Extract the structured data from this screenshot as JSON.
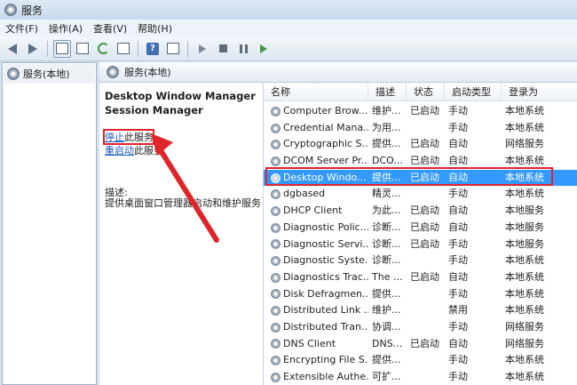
{
  "window": {
    "title": "服务"
  },
  "menu": [
    "文件(F)",
    "操作(A)",
    "查看(V)",
    "帮助(H)"
  ],
  "left_tree": {
    "item": "服务(本地)"
  },
  "right_header": {
    "title": "服务(本地)"
  },
  "detail": {
    "service_name_line1": "Desktop Window Manager",
    "service_name_line2": "Session Manager",
    "stop_link": "停止",
    "stop_suffix": "此服务",
    "restart_link": "重启动",
    "restart_suffix": "此服务",
    "description_label": "描述:",
    "description": "提供桌面窗口管理器启动和维护服务"
  },
  "columns": {
    "name": "名称",
    "description": "描述",
    "status": "状态",
    "startup_type": "启动类型",
    "logon_as": "登录为"
  },
  "services": [
    {
      "name": "Computer Brow...",
      "description": "维护...",
      "status": "已启动",
      "startup": "手动",
      "logon": "本地系统",
      "selected": false
    },
    {
      "name": "Credential Mana...",
      "description": "为用...",
      "status": "",
      "startup": "手动",
      "logon": "本地系统",
      "selected": false
    },
    {
      "name": "Cryptographic S...",
      "description": "提供...",
      "status": "已启动",
      "startup": "自动",
      "logon": "网络服务",
      "selected": false
    },
    {
      "name": "DCOM Server Pr...",
      "description": "DCO...",
      "status": "已启动",
      "startup": "自动",
      "logon": "本地系统",
      "selected": false
    },
    {
      "name": "Desktop Windo...",
      "description": "提供...",
      "status": "已启动",
      "startup": "自动",
      "logon": "本地系统",
      "selected": true
    },
    {
      "name": "dgbased",
      "description": "精灵...",
      "status": "",
      "startup": "手动",
      "logon": "本地系统",
      "selected": false
    },
    {
      "name": "DHCP Client",
      "description": "为此...",
      "status": "已启动",
      "startup": "自动",
      "logon": "本地服务",
      "selected": false
    },
    {
      "name": "Diagnostic Polic...",
      "description": "诊断...",
      "status": "已启动",
      "startup": "自动",
      "logon": "本地服务",
      "selected": false
    },
    {
      "name": "Diagnostic Servi...",
      "description": "诊断...",
      "status": "已启动",
      "startup": "手动",
      "logon": "本地服务",
      "selected": false
    },
    {
      "name": "Diagnostic Syste...",
      "description": "诊断...",
      "status": "",
      "startup": "手动",
      "logon": "本地系统",
      "selected": false
    },
    {
      "name": "Diagnostics Trac...",
      "description": "The ...",
      "status": "已启动",
      "startup": "自动",
      "logon": "本地系统",
      "selected": false
    },
    {
      "name": "Disk Defragmen...",
      "description": "提供...",
      "status": "",
      "startup": "手动",
      "logon": "本地系统",
      "selected": false
    },
    {
      "name": "Distributed Link ...",
      "description": "维护...",
      "status": "",
      "startup": "禁用",
      "logon": "本地系统",
      "selected": false
    },
    {
      "name": "Distributed Tran...",
      "description": "协调...",
      "status": "",
      "startup": "手动",
      "logon": "网络服务",
      "selected": false
    },
    {
      "name": "DNS Client",
      "description": "DNS...",
      "status": "已启动",
      "startup": "自动",
      "logon": "网络服务",
      "selected": false
    },
    {
      "name": "Encrypting File S...",
      "description": "提供...",
      "status": "",
      "startup": "手动",
      "logon": "本地系统",
      "selected": false
    },
    {
      "name": "Extensible Authe...",
      "description": "可扩...",
      "status": "",
      "startup": "手动",
      "logon": "本地系统",
      "selected": false
    }
  ],
  "colors": {
    "selection": "#3399ff",
    "annotation_red": "#e0242b",
    "link": "#1d5dbd"
  }
}
